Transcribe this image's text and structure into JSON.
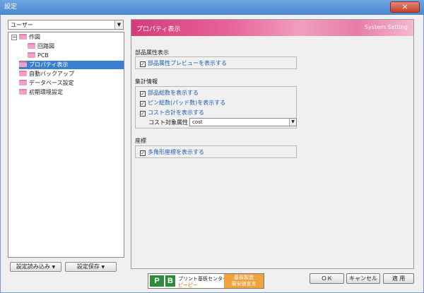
{
  "window": {
    "title": "設定",
    "close_symbol": "×"
  },
  "sidebar": {
    "user_select": {
      "value": "ユーザー",
      "arrow": "▼"
    },
    "tree": [
      {
        "label": "作図",
        "expander": "−"
      },
      {
        "label": "回路図"
      },
      {
        "label": "PCB"
      },
      {
        "label": "プロパティ表示"
      },
      {
        "label": "自動バックアップ"
      },
      {
        "label": "データベース設定"
      },
      {
        "label": "初期環境設定"
      }
    ],
    "load_button": "設定読み込み",
    "save_button": "設定保存",
    "dropdown_arrow": "▼"
  },
  "panel": {
    "title": "プロパティ表示",
    "system_label": "System Setting",
    "sections": [
      {
        "label": "部品属性表示",
        "checks": [
          {
            "label": "部品属性プレビューを表示する",
            "checked": true
          }
        ]
      },
      {
        "label": "集計情報",
        "checks": [
          {
            "label": "部品総数を表示する",
            "checked": true
          },
          {
            "label": "ピン総数(パッド数)を表示する",
            "checked": true
          },
          {
            "label": "コスト合計を表示する",
            "checked": true
          }
        ],
        "cost_field": {
          "label": "コスト対象属性",
          "value": "cost",
          "arrow": "▼"
        }
      },
      {
        "label": "座標",
        "checks": [
          {
            "label": "多角形座標を表示する",
            "checked": true
          }
        ]
      }
    ],
    "check_mark": "✓"
  },
  "footer": {
    "logo": {
      "letter1": "P",
      "letter2": "B",
      "brand_line1": "プリント基板センター",
      "brand_line2": "ピーピー",
      "promo_line1": "基板製造",
      "promo_line2": "最安値宣言"
    },
    "ok_button": "ＯＫ",
    "cancel_button": "キャンセル",
    "apply_button": "適 用"
  },
  "colors": {
    "titlebar": "#4a88cf",
    "banner": "#e76497",
    "selection": "#3c7fd0",
    "folder": "#f0a2c6",
    "logo_green": "#2e8b3a",
    "promo_orange": "#f0a23c"
  }
}
